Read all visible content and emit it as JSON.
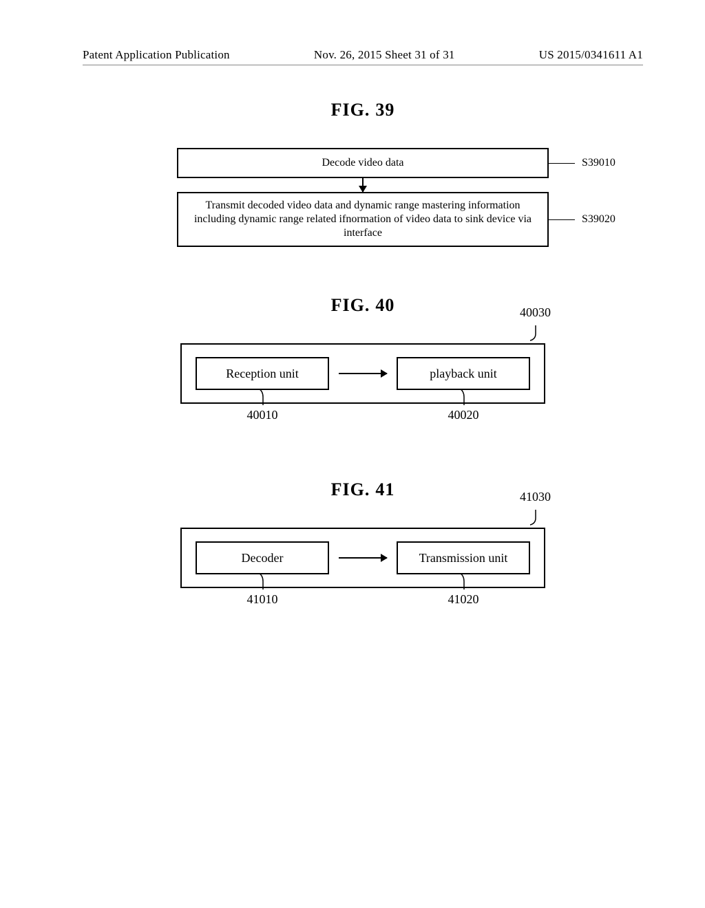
{
  "header": {
    "left": "Patent Application Publication",
    "center": "Nov. 26, 2015  Sheet 31 of 31",
    "right": "US 2015/0341611 A1"
  },
  "fig39": {
    "title_word": "FIG.",
    "title_num": "39",
    "step1": {
      "text": "Decode video data",
      "ref": "S39010"
    },
    "step2": {
      "text": "Transmit decoded video data and dynamic range mastering information including dynamic range related ifnormation of video data to sink device via interface",
      "ref": "S39020"
    }
  },
  "fig40": {
    "title_word": "FIG.",
    "title_num": "40",
    "outer_ref": "40030",
    "left": {
      "label": "Reception unit",
      "ref": "40010"
    },
    "right": {
      "label": "playback unit",
      "ref": "40020"
    }
  },
  "fig41": {
    "title_word": "FIG.",
    "title_num": "41",
    "outer_ref": "41030",
    "left": {
      "label": "Decoder",
      "ref": "41010"
    },
    "right": {
      "label": "Transmission unit",
      "ref": "41020"
    }
  }
}
